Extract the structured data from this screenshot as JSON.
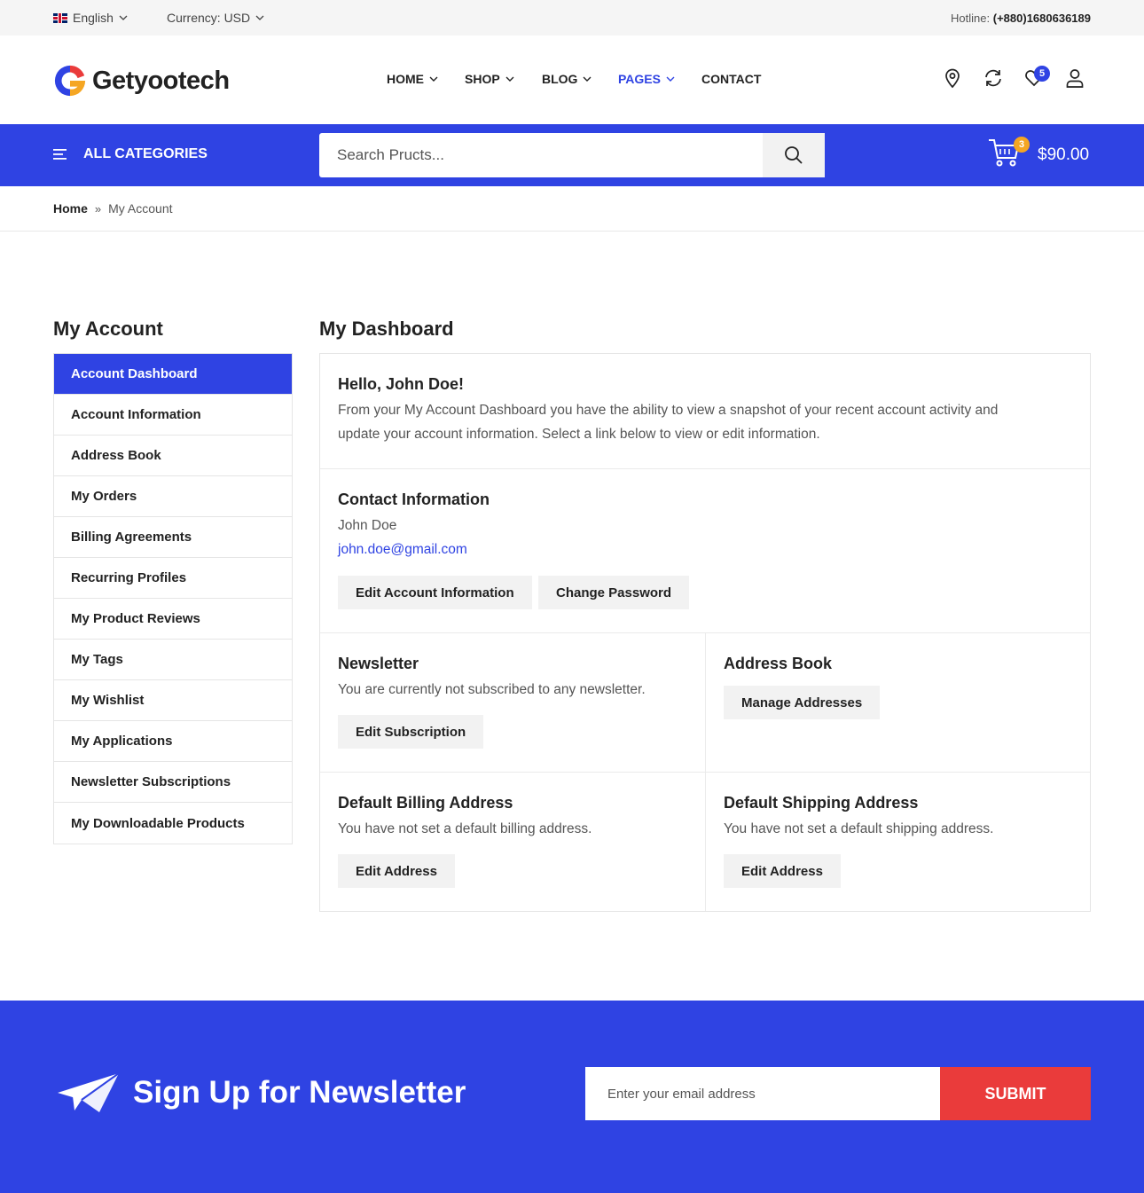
{
  "topbar": {
    "language": "English",
    "currency": "Currency: USD",
    "hotline_label": "Hotline:",
    "hotline_number": "(+880)1680636189"
  },
  "header": {
    "logo_text": "Getyootech",
    "nav": [
      {
        "label": "HOME",
        "dropdown": true
      },
      {
        "label": "SHOP",
        "dropdown": true
      },
      {
        "label": "BLOG",
        "dropdown": true
      },
      {
        "label": "PAGES",
        "dropdown": true,
        "active": true
      },
      {
        "label": "CONTACT",
        "dropdown": false
      }
    ],
    "icons": [
      "location-pin-icon",
      "compare-refresh-icon",
      "heart-icon",
      "user-icon"
    ],
    "wishlist_count": "5"
  },
  "bluebar": {
    "all_categories": "ALL CATEGORIES",
    "search_placeholder": "Search Pructs...",
    "cart_count": "3",
    "cart_total": "$90.00"
  },
  "breadcrumb": {
    "home": "Home",
    "current": "My Account"
  },
  "sidebar": {
    "title": "My Account",
    "items": [
      "Account Dashboard",
      "Account Information",
      "Address Book",
      "My Orders",
      "Billing Agreements",
      "Recurring Profiles",
      "My Product Reviews",
      "My Tags",
      "My Wishlist",
      "My Applications",
      "Newsletter Subscriptions",
      "My Downloadable Products"
    ]
  },
  "dashboard": {
    "title": "My Dashboard",
    "greeting": "Hello, John Doe!",
    "intro_line1": "From your My Account Dashboard you have the ability to view a snapshot of your recent account activity and",
    "intro_line2": "update your account information. Select a link below to view or edit information.",
    "contact": {
      "title": "Contact Information",
      "name": "John Doe",
      "email": "john.doe@gmail.com",
      "edit_button": "Edit Account Information",
      "password_button": "Change Password"
    },
    "newsletter": {
      "title": "Newsletter",
      "text": "You are currently not subscribed to any newsletter.",
      "button": "Edit Subscription"
    },
    "address_book": {
      "title": "Address Book",
      "button": "Manage Addresses"
    },
    "billing": {
      "title": "Default Billing Address",
      "text": "You have not set a default billing address.",
      "button": "Edit Address"
    },
    "shipping": {
      "title": "Default Shipping Address",
      "text": "You have not set a default shipping address.",
      "button": "Edit Address"
    }
  },
  "newsletter_footer": {
    "title": "Sign Up for Newsletter",
    "placeholder": "Enter your email address",
    "submit": "SUBMIT"
  },
  "colors": {
    "brand_blue": "#2f43e3",
    "submit_red": "#ea3b3b",
    "badge_orange": "#f5a623"
  }
}
